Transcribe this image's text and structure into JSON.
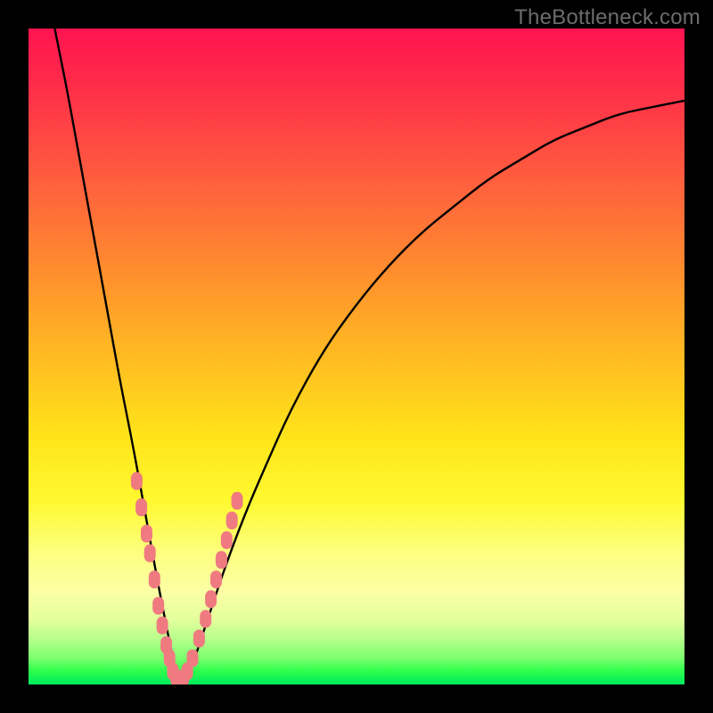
{
  "watermark": "TheBottleneck.com",
  "colors": {
    "frame": "#000000",
    "curve_stroke": "#000000",
    "marker_fill": "#ef7b81",
    "gradient_stops": [
      "#ff1450",
      "#ff2a4a",
      "#ff5a3f",
      "#ff8a2f",
      "#ffbb22",
      "#ffe31a",
      "#fff930",
      "#fdff80",
      "#fbffa5",
      "#e4ff9c",
      "#b8ff8c",
      "#7cff6e",
      "#2bff4c",
      "#00e85e"
    ]
  },
  "chart_data": {
    "type": "line",
    "title": "",
    "xlabel": "",
    "ylabel": "",
    "xlim": [
      0,
      100
    ],
    "ylim": [
      0,
      100
    ],
    "note": "x ≈ normalized component score, y ≈ bottleneck percentage; curve minimum near x≈23 with y≈0; two branches: steep left, shallower right.",
    "series": [
      {
        "name": "bottleneck-curve",
        "x": [
          4,
          6,
          8,
          10,
          12,
          14,
          16,
          18,
          20,
          21,
          22,
          23,
          24,
          25,
          26,
          28,
          30,
          33,
          36,
          40,
          45,
          50,
          55,
          60,
          65,
          70,
          75,
          80,
          85,
          90,
          95,
          100
        ],
        "y": [
          100,
          90,
          79,
          68,
          57,
          46,
          36,
          25,
          14,
          9,
          4,
          0,
          1,
          3,
          6,
          12,
          18,
          26,
          33,
          42,
          51,
          58,
          64,
          69,
          73,
          77,
          80,
          83,
          85,
          87,
          88,
          89
        ]
      }
    ],
    "markers": {
      "name": "sample-points",
      "approximate": true,
      "x": [
        16.5,
        17.2,
        18.0,
        18.5,
        19.2,
        19.8,
        20.4,
        21.0,
        21.5,
        22.0,
        22.5,
        23.0,
        23.6,
        24.2,
        25.0,
        26.0,
        27.0,
        27.8,
        28.6,
        29.4,
        30.2,
        31.0,
        31.8
      ],
      "y": [
        31,
        27,
        23,
        20,
        16,
        12,
        9,
        6,
        4,
        2,
        1,
        0,
        1,
        2,
        4,
        7,
        10,
        13,
        16,
        19,
        22,
        25,
        28
      ]
    }
  }
}
